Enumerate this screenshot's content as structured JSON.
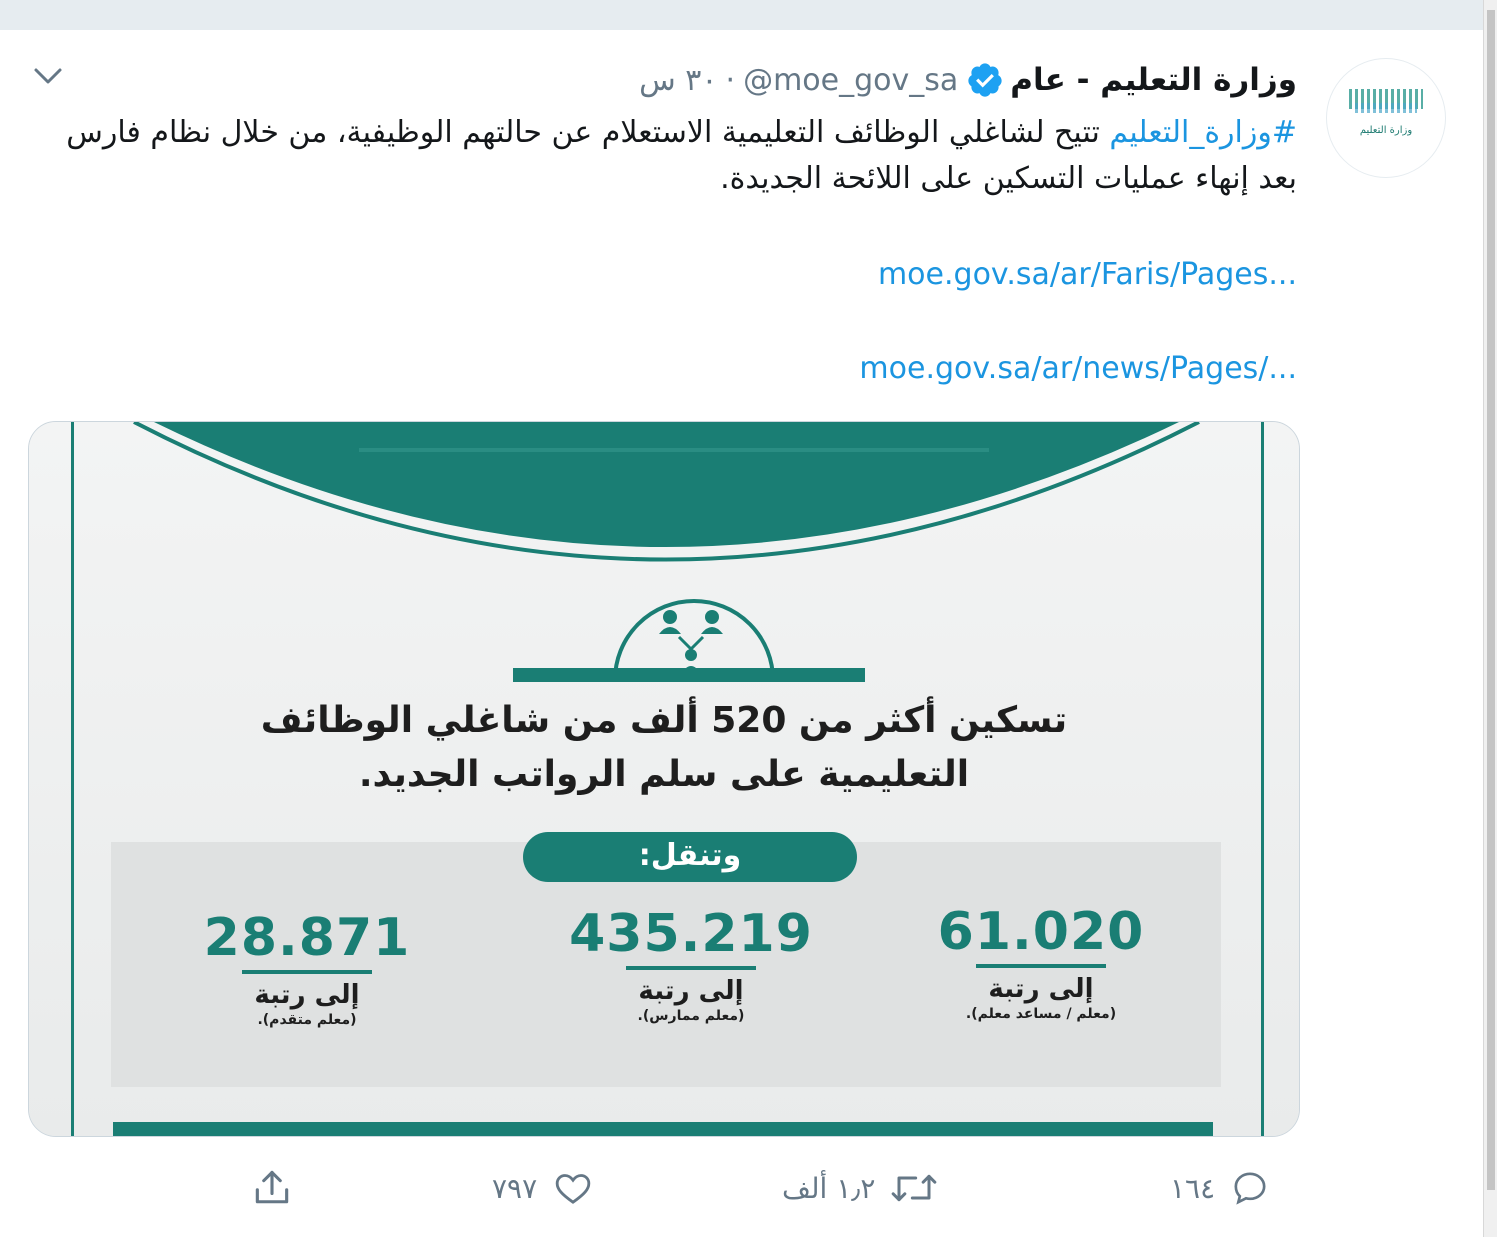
{
  "tweet": {
    "display_name": "وزارة التعليم - عام",
    "handle": "@moe_gov_sa",
    "separator": "·",
    "time": "٣٠ س",
    "hashtag": "#وزارة_التعليم",
    "text": " تتيح لشاغلي الوظائف التعليمية الاستعلام عن حالتهم الوظيفية، من خلال نظام فارس بعد إنهاء عمليات التسكين على اللائحة الجديدة.",
    "links": [
      "moe.gov.sa/ar/Faris/Pages...",
      "moe.gov.sa/ar/news/Pages/..."
    ],
    "avatar_text": "وزارة التعليم"
  },
  "media": {
    "headline_line1": "تسكين أكثر من 520 ألف من شاغلي الوظائف",
    "headline_line2": "التعليمية على سلم الرواتب الجديد.",
    "pill": "وتنقل:",
    "stats": [
      {
        "value": "61.020",
        "label": "إلى رتبة",
        "sub": "(معلم / مساعد معلم)."
      },
      {
        "value": "435.219",
        "label": "إلى رتبة",
        "sub": "(معلم ممارس)."
      },
      {
        "value": "28.871",
        "label": "إلى رتبة",
        "sub": "(معلم متقدم)."
      }
    ]
  },
  "actions": {
    "replies": "١٦٤",
    "retweets": "١٫٢ ألف",
    "likes": "٧٩٧"
  },
  "colors": {
    "accent": "#1b95e0",
    "brand_green": "#1a7e74",
    "text": "#14171a",
    "muted": "#657786"
  }
}
